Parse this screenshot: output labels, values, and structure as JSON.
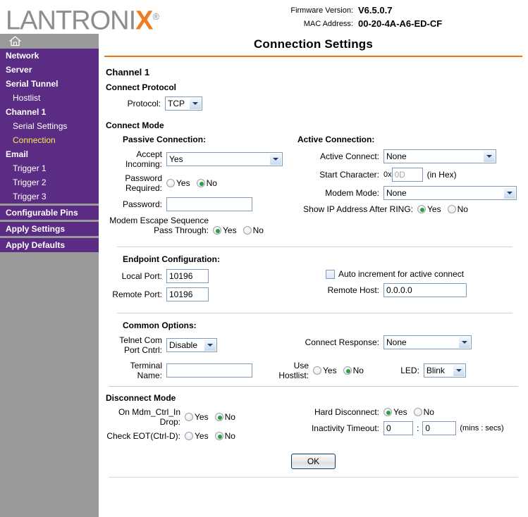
{
  "header": {
    "logo_text": "LANTRONI",
    "logo_x": "X",
    "logo_reg": "®",
    "firmware_label": "Firmware Version:",
    "firmware_value": "V6.5.0.7",
    "mac_label": "MAC Address:",
    "mac_value": "00-20-4A-A6-ED-CF"
  },
  "sidebar": {
    "home_icon": "home-icon",
    "items": [
      {
        "label": "Network",
        "level": 0,
        "current": false
      },
      {
        "label": "Server",
        "level": 0,
        "current": false
      },
      {
        "label": "Serial Tunnel",
        "level": 0,
        "current": false
      },
      {
        "label": "Hostlist",
        "level": 1,
        "current": false
      },
      {
        "label": "Channel 1",
        "level": 0,
        "current": false
      },
      {
        "label": "Serial Settings",
        "level": 1,
        "current": false
      },
      {
        "label": "Connection",
        "level": 1,
        "current": true
      },
      {
        "label": "Email",
        "level": 0,
        "current": false
      },
      {
        "label": "Trigger 1",
        "level": 1,
        "current": false
      },
      {
        "label": "Trigger 2",
        "level": 1,
        "current": false
      },
      {
        "label": "Trigger 3",
        "level": 1,
        "current": false
      },
      {
        "label": "Configurable Pins",
        "level": 0,
        "current": false
      },
      {
        "label": "Apply Settings",
        "level": 0,
        "current": false
      },
      {
        "label": "Apply Defaults",
        "level": 0,
        "current": false
      }
    ]
  },
  "page": {
    "title": "Connection Settings",
    "channel": "Channel 1"
  },
  "connect_protocol": {
    "heading": "Connect Protocol",
    "protocol_label": "Protocol:",
    "protocol_value": "TCP"
  },
  "connect_mode": {
    "heading": "Connect Mode",
    "passive_heading": "Passive Connection:",
    "active_heading": "Active Connection:",
    "accept_incoming_label": "Accept Incoming:",
    "accept_incoming_value": "Yes",
    "password_required_label": "Password Required:",
    "password_required_yes": "Yes",
    "password_required_no": "No",
    "password_required_selected": "No",
    "password_label": "Password:",
    "password_value": "",
    "modem_escape_label": "Modem Escape Sequence Pass Through:",
    "modem_escape_yes": "Yes",
    "modem_escape_no": "No",
    "modem_escape_selected": "Yes",
    "active_connect_label": "Active Connect:",
    "active_connect_value": "None",
    "start_char_label": "Start Character:",
    "start_char_prefix": "0x",
    "start_char_value": "0D",
    "start_char_suffix": "(in Hex)",
    "modem_mode_label": "Modem Mode:",
    "modem_mode_value": "None",
    "show_ip_label": "Show IP Address After RING:",
    "show_ip_yes": "Yes",
    "show_ip_no": "No",
    "show_ip_selected": "Yes"
  },
  "endpoint": {
    "heading": "Endpoint Configuration:",
    "local_port_label": "Local Port:",
    "local_port_value": "10196",
    "remote_port_label": "Remote Port:",
    "remote_port_value": "10196",
    "auto_increment_label": "Auto increment for active connect",
    "auto_increment_checked": false,
    "remote_host_label": "Remote Host:",
    "remote_host_value": "0.0.0.0"
  },
  "common": {
    "heading": "Common Options:",
    "telnet_label": "Telnet Com Port Cntrl:",
    "telnet_value": "Disable",
    "connect_response_label": "Connect Response:",
    "connect_response_value": "None",
    "terminal_name_label": "Terminal Name:",
    "terminal_name_value": "",
    "use_hostlist_label": "Use Hostlist:",
    "use_hostlist_yes": "Yes",
    "use_hostlist_no": "No",
    "use_hostlist_selected": "No",
    "led_label": "LED:",
    "led_value": "Blink"
  },
  "disconnect": {
    "heading": "Disconnect Mode",
    "mdm_ctrl_label": "On Mdm_Ctrl_In Drop:",
    "mdm_ctrl_yes": "Yes",
    "mdm_ctrl_no": "No",
    "mdm_ctrl_selected": "No",
    "check_eot_label": "Check EOT(Ctrl-D):",
    "check_eot_yes": "Yes",
    "check_eot_no": "No",
    "check_eot_selected": "No",
    "hard_disconnect_label": "Hard Disconnect:",
    "hard_disconnect_yes": "Yes",
    "hard_disconnect_no": "No",
    "hard_disconnect_selected": "Yes",
    "inactivity_label": "Inactivity Timeout:",
    "inactivity_mins": "0",
    "inactivity_separator": ":",
    "inactivity_secs": "0",
    "inactivity_units": "(mins : secs)"
  },
  "footer": {
    "ok_label": "OK"
  },
  "colors": {
    "nav_purple": "#5b2c83",
    "sidebar_grey": "#9a9a9a",
    "accent_orange": "#e8740c",
    "current_yellow": "#ffe94f",
    "logo_grey": "#8d8d8d"
  }
}
